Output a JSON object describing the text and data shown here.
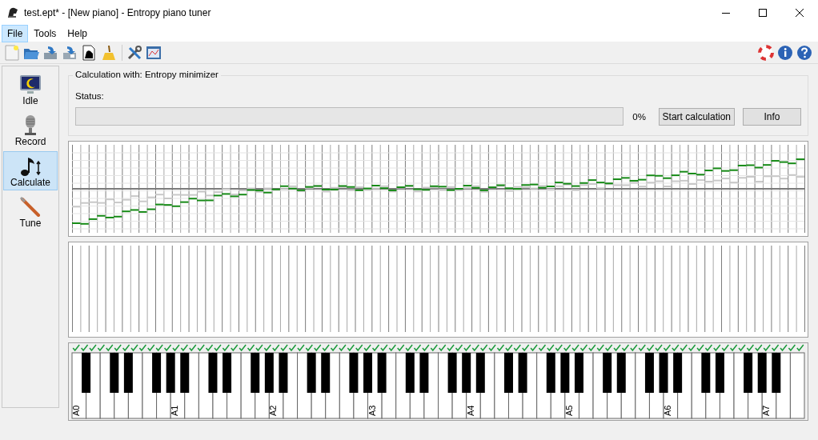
{
  "window": {
    "title": "test.ept* - [New piano] - Entropy piano tuner"
  },
  "menu": [
    {
      "label": "File",
      "selected": true
    },
    {
      "label": "Tools",
      "selected": false
    },
    {
      "label": "Help",
      "selected": false
    }
  ],
  "sidebar": {
    "items": [
      {
        "label": "Idle",
        "kind": "idle",
        "selected": false
      },
      {
        "label": "Record",
        "kind": "record",
        "selected": false
      },
      {
        "label": "Calculate",
        "kind": "calculate",
        "selected": true
      },
      {
        "label": "Tune",
        "kind": "tune",
        "selected": false
      }
    ]
  },
  "calculation": {
    "title": "Calculation with: Entropy minimizer",
    "status_label": "Status:",
    "level": 0,
    "reading": "0%",
    "buttons": [
      "Start calculation",
      "Info"
    ]
  },
  "keyboard": {
    "labels": [
      "A0",
      "A1",
      "A2",
      "A3",
      "A4",
      "A5",
      "A6",
      "A7"
    ],
    "all_keys_checked": true
  }
}
